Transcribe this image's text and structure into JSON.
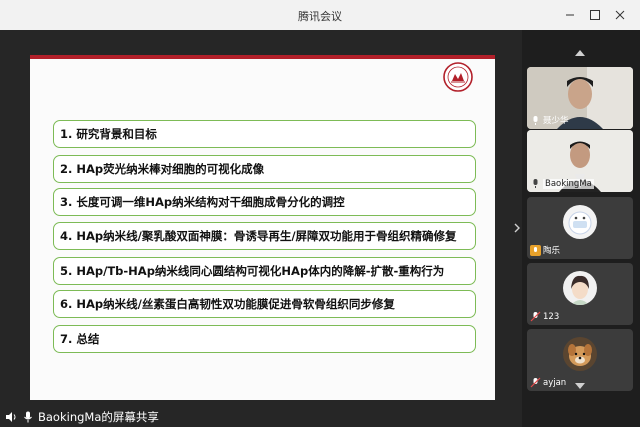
{
  "window": {
    "title": "腾讯会议"
  },
  "slide": {
    "items": [
      "1. 研究背景和目标",
      "2. HAp荧光纳米棒对细胞的可视化成像",
      "3. 长度可调一维HAp纳米结构对干细胞成骨分化的调控",
      "4. HAp纳米线/聚乳酸双面神膜：骨诱导再生/屏障双功能用于骨组织精确修复",
      "5. HAp/Tb-HAp纳米线同心圆结构可视化HAp体内的降解-扩散-重构行为",
      "6. HAp纳米线/丝素蛋白高韧性双功能膜促进骨软骨组织同步修复",
      "7. 总结"
    ]
  },
  "share_status": "BaokingMa的屏幕共享",
  "participants": [
    {
      "name": "聂少华"
    },
    {
      "name": "BaokingMa"
    },
    {
      "name": "陶乐"
    },
    {
      "name": "123"
    },
    {
      "name": "ayjan"
    }
  ],
  "colors": {
    "accent": "#7dbb56",
    "brand": "#b2202a"
  }
}
